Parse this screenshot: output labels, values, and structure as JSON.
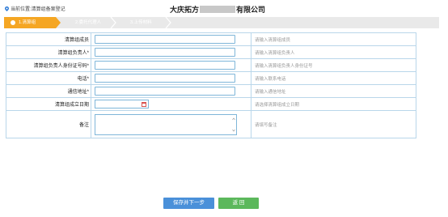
{
  "location": {
    "prefix": "当前位置:",
    "page": "清算组备案登记"
  },
  "company": {
    "name_start": "大庆拓方",
    "name_end": "有限公司"
  },
  "steps": [
    {
      "label": "1.清算组",
      "active": true
    },
    {
      "label": "2.委托代理人",
      "active": false
    },
    {
      "label": "3.上传材料",
      "active": false
    }
  ],
  "form": {
    "rows": [
      {
        "label": "清算组成员",
        "hint": "请输入清算组成员",
        "value": ""
      },
      {
        "label": "清算组负责人*",
        "hint": "请输入清算组负责人",
        "value": ""
      },
      {
        "label": "清算组负责人身份证号码*",
        "hint": "请输入清算组负责人身份证号",
        "value": ""
      },
      {
        "label": "电话*",
        "hint": "请输入联系电话",
        "value": ""
      },
      {
        "label": "通信地址*",
        "hint": "请输入通信地址",
        "value": ""
      }
    ],
    "date_row": {
      "label": "清算组成立日期",
      "hint": "请选择清算组成立日期",
      "value": ""
    },
    "remark_row": {
      "label": "备注",
      "hint": "请填写备注",
      "value": ""
    }
  },
  "buttons": {
    "save": "保存并下一步",
    "back": "返 回"
  },
  "colors": {
    "active_step": "#f5a623",
    "step_bar": "#e9e9e9",
    "border": "#b9d6ea",
    "save_button": "#4a90d9",
    "back_button": "#5cb85c"
  }
}
